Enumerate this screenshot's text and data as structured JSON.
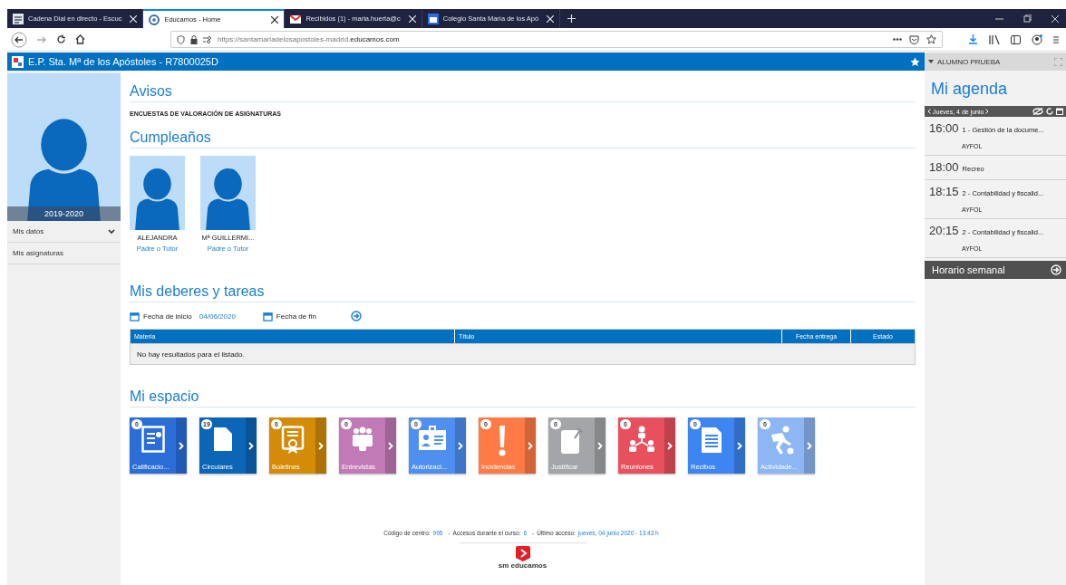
{
  "browser": {
    "tabs": [
      {
        "title": "Cadena Dial en directo - Escuc",
        "selected": false,
        "kind": "radio"
      },
      {
        "title": "Educamos - Home",
        "selected": true,
        "kind": "globe"
      },
      {
        "title": "Recibidos (1) - maria.huerta@c",
        "selected": false,
        "kind": "mail"
      },
      {
        "title": "Colegio Santa María de los Apó",
        "selected": false,
        "kind": "calendar"
      }
    ],
    "url": {
      "prefix": "https://santamariadelosapostoles-madrid.",
      "domain": "educamos.com"
    }
  },
  "header": {
    "school": "E.P. Sta. Mª de los Apóstoles - R7800025D"
  },
  "sidebar": {
    "year": "2019-2020",
    "items": [
      {
        "label": "Mis datos",
        "expandable": true
      },
      {
        "label": "Mis asignaturas",
        "expandable": false
      }
    ]
  },
  "avisos": {
    "title": "Avisos",
    "items": [
      "ENCUESTAS DE VALORACIÓN DE ASIGNATURAS"
    ]
  },
  "cumpleanos": {
    "title": "Cumpleaños",
    "people": [
      {
        "name": "ALEJANDRA",
        "role": "Padre o Tutor"
      },
      {
        "name": "Mª GUILLERMI...",
        "role": "Padre o Tutor"
      }
    ]
  },
  "deberes": {
    "title": "Mis deberes y tareas",
    "start_label": "Fecha de inicio",
    "start_value": "04/06/2020",
    "end_label": "Fecha de fin",
    "table": {
      "columns": [
        "Materia",
        "Título",
        "Fecha entrega",
        "Estado"
      ],
      "empty": "No hay resultados para el listado."
    }
  },
  "espacio": {
    "title": "Mi espacio",
    "tiles": [
      {
        "label": "Calificacio...",
        "count": "0",
        "color": "#2b6ed8",
        "kind": "certificate"
      },
      {
        "label": "Circulares",
        "count": "19",
        "color": "#0b66b8",
        "kind": "page"
      },
      {
        "label": "Boletines",
        "count": "0",
        "color": "#d38b08",
        "kind": "diploma"
      },
      {
        "label": "Entrevistas",
        "count": "0",
        "color": "#c27ab6",
        "kind": "people"
      },
      {
        "label": "Autorizaci...",
        "count": "0",
        "color": "#4f8ff0",
        "kind": "idcard"
      },
      {
        "label": "Incidencias",
        "count": "0",
        "color": "#ff7a45",
        "kind": "exclaim"
      },
      {
        "label": "Justificar",
        "count": "0",
        "color": "#a3a5a8",
        "kind": "pin"
      },
      {
        "label": "Reuniones",
        "count": "0",
        "color": "#e8505e",
        "kind": "network"
      },
      {
        "label": "Recibos",
        "count": "0",
        "color": "#3d85f0",
        "kind": "list"
      },
      {
        "label": "Actividade...",
        "count": "0",
        "color": "#8db6f5",
        "kind": "runner"
      }
    ]
  },
  "footer": {
    "items": [
      {
        "label": "Código de centro:",
        "value": "995"
      },
      {
        "label": "Accesos durante el curso:",
        "value": "6"
      },
      {
        "label": "Último acceso:",
        "value": "jueves, 04 junio 2020 - 13:43 h"
      }
    ],
    "separators": [
      "-",
      "-"
    ],
    "logo": "sm educamos"
  },
  "agenda": {
    "user": "ALUMNO PRUEBA",
    "title": "Mi agenda",
    "date": "Jueves, 4 de junio",
    "events": [
      {
        "time": "16:00",
        "title": "1 - Gestión de la docume...",
        "group": "AYFOL"
      },
      {
        "time": "18:00",
        "title": "Recreo"
      },
      {
        "time": "18:15",
        "title": "2 - Contabilidad y fiscalid...",
        "group": "AYFOL"
      },
      {
        "time": "20:15",
        "title": "2 - Contabilidad y fiscalid...",
        "group": "AYFOL"
      }
    ],
    "weekly": "Horario semanal"
  }
}
